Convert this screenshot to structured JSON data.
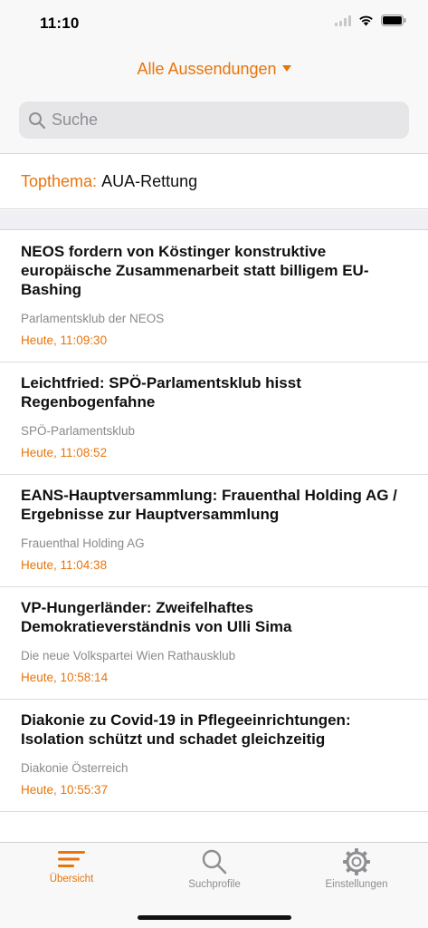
{
  "status": {
    "time": "11:10"
  },
  "header": {
    "filter_label": "Alle Aussendungen",
    "search_placeholder": "Suche"
  },
  "topthema": {
    "label": "Topthema:",
    "value": "AUA-Rettung"
  },
  "articles": [
    {
      "title": "NEOS fordern von Köstinger konstruktive europäische Zusammenarbeit statt billigem EU-Bashing",
      "source": "Parlamentsklub der NEOS",
      "time": "Heute, 11:09:30"
    },
    {
      "title": "Leichtfried: SPÖ-Parlamentsklub hisst Regenbogenfahne",
      "source": "SPÖ-Parlamentsklub",
      "time": "Heute, 11:08:52"
    },
    {
      "title": "EANS-Hauptversammlung: Frauenthal Holding AG / Ergebnisse zur Hauptversammlung",
      "source": "Frauenthal Holding AG",
      "time": "Heute, 11:04:38"
    },
    {
      "title": "VP-Hungerländer: Zweifelhaftes Demokratieverständnis von Ulli Sima",
      "source": "Die neue Volkspartei Wien Rathausklub",
      "time": "Heute, 10:58:14"
    },
    {
      "title": "Diakonie zu Covid-19 in Pflegeeinrichtungen: Isolation schützt und schadet gleichzeitig",
      "source": "Diakonie Österreich",
      "time": "Heute, 10:55:37"
    }
  ],
  "tabbar": {
    "tabs": [
      {
        "label": "Übersicht",
        "icon": "list-icon",
        "active": true
      },
      {
        "label": "Suchprofile",
        "icon": "search-icon",
        "active": false
      },
      {
        "label": "Einstellungen",
        "icon": "gear-icon",
        "active": false
      }
    ]
  },
  "colors": {
    "accent": "#e8750c",
    "secondary_text": "#8a8a8e",
    "separator": "#efeff4"
  }
}
